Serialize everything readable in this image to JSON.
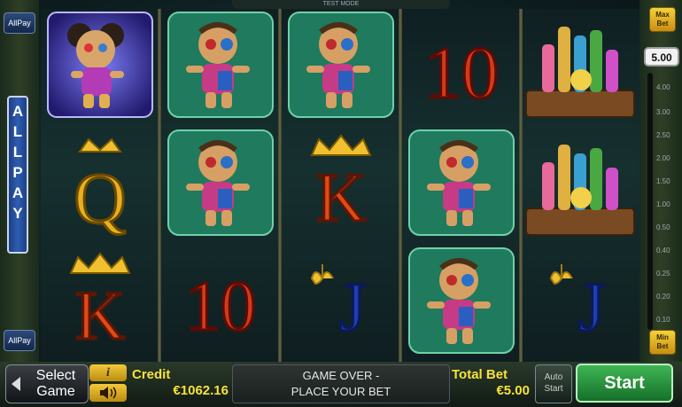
{
  "top_label": "TEST MODE",
  "left_panel": {
    "allpay_top": "AllPay",
    "allpay_vertical": [
      "A",
      "L",
      "L",
      "P",
      "A",
      "Y"
    ],
    "allpay_bottom": "AllPay"
  },
  "right_panel": {
    "max_bet": [
      "Max",
      "Bet"
    ],
    "bet_value": "5.00",
    "scale": [
      "4.00",
      "3.00",
      "2.50",
      "2.00",
      "1.50",
      "1.00",
      "0.50",
      "0.40",
      "0.25",
      "0.20",
      "0.10"
    ],
    "min_bet": [
      "Min",
      "Bet"
    ]
  },
  "reels": [
    [
      "voodoo_doll_wild",
      "Q",
      "K"
    ],
    [
      "voodoo_doll",
      "voodoo_doll",
      "10"
    ],
    [
      "voodoo_doll",
      "K",
      "J"
    ],
    [
      "10",
      "voodoo_doll",
      "voodoo_doll"
    ],
    [
      "potions",
      "potions",
      "J"
    ]
  ],
  "bottom": {
    "select_line1": "Select",
    "select_line2": "Game",
    "info_label": "i",
    "credit_label": "Credit",
    "credit_value": "€1062.16",
    "message_line1": "GAME OVER -",
    "message_line2": "PLACE YOUR BET",
    "total_bet_label": "Total Bet",
    "total_bet_value": "€5.00",
    "auto_line1": "Auto",
    "auto_line2": "Start",
    "start_label": "Start"
  },
  "colors": {
    "gold": "#f7e23a",
    "start_green": "#2fa046",
    "card_red": "#d33a1a",
    "card_blue": "#1f3fb0"
  }
}
